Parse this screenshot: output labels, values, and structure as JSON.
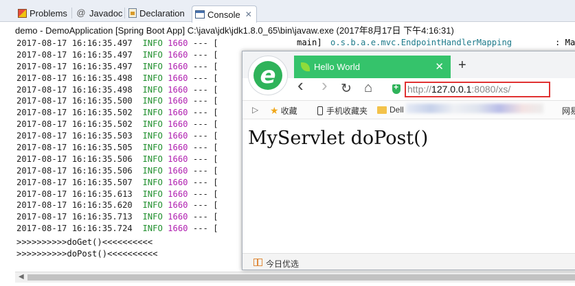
{
  "tabs": [
    {
      "label": "Problems",
      "icon": "problems-icon"
    },
    {
      "label": "Javadoc",
      "icon": "at-sign-icon",
      "glyph": "@"
    },
    {
      "label": "Declaration",
      "icon": "declaration-icon"
    },
    {
      "label": "Console",
      "icon": "console-icon",
      "active": true,
      "close": "✕"
    }
  ],
  "console": {
    "header": "demo - DemoApplication [Spring Boot App] C:\\java\\jdk\\jdk1.8.0_65\\bin\\javaw.exe (2017年8月17日 下午4:16:31)",
    "first_line_thread": "main]",
    "first_line_class": "o.s.b.a.e.mvc.EndpointHandlerMapping",
    "first_line_tail": ": Ma",
    "log_rows": [
      {
        "time": "2017-08-17 16:16:35.497",
        "level": "INFO",
        "pid": "1660",
        "sep": "--- ["
      },
      {
        "time": "2017-08-17 16:16:35.497",
        "level": "INFO",
        "pid": "1660",
        "sep": "--- ["
      },
      {
        "time": "2017-08-17 16:16:35.497",
        "level": "INFO",
        "pid": "1660",
        "sep": "--- ["
      },
      {
        "time": "2017-08-17 16:16:35.498",
        "level": "INFO",
        "pid": "1660",
        "sep": "--- ["
      },
      {
        "time": "2017-08-17 16:16:35.498",
        "level": "INFO",
        "pid": "1660",
        "sep": "--- ["
      },
      {
        "time": "2017-08-17 16:16:35.500",
        "level": "INFO",
        "pid": "1660",
        "sep": "--- ["
      },
      {
        "time": "2017-08-17 16:16:35.502",
        "level": "INFO",
        "pid": "1660",
        "sep": "--- ["
      },
      {
        "time": "2017-08-17 16:16:35.502",
        "level": "INFO",
        "pid": "1660",
        "sep": "--- ["
      },
      {
        "time": "2017-08-17 16:16:35.503",
        "level": "INFO",
        "pid": "1660",
        "sep": "--- ["
      },
      {
        "time": "2017-08-17 16:16:35.505",
        "level": "INFO",
        "pid": "1660",
        "sep": "--- ["
      },
      {
        "time": "2017-08-17 16:16:35.506",
        "level": "INFO",
        "pid": "1660",
        "sep": "--- ["
      },
      {
        "time": "2017-08-17 16:16:35.506",
        "level": "INFO",
        "pid": "1660",
        "sep": "--- ["
      },
      {
        "time": "2017-08-17 16:16:35.507",
        "level": "INFO",
        "pid": "1660",
        "sep": "--- ["
      },
      {
        "time": "2017-08-17 16:16:35.613",
        "level": "INFO",
        "pid": "1660",
        "sep": "--- ["
      },
      {
        "time": "2017-08-17 16:16:35.620",
        "level": "INFO",
        "pid": "1660",
        "sep": "--- ["
      },
      {
        "time": "2017-08-17 16:16:35.713",
        "level": "INFO",
        "pid": "1660",
        "sep": "--- ["
      },
      {
        "time": "2017-08-17 16:16:35.724",
        "level": "INFO",
        "pid": "1660",
        "sep": "--- ["
      }
    ],
    "output_lines": [
      ">>>>>>>>>>doGet()<<<<<<<<<<",
      ">>>>>>>>>>doPost()<<<<<<<<<<"
    ]
  },
  "browser": {
    "tab_title": "Hello World",
    "tab_close": "✕",
    "new_tab": "+",
    "nav": {
      "back": "‹",
      "forward": "›",
      "reload": "↻",
      "home": "⌂"
    },
    "url": {
      "scheme": "http://",
      "host": "127.0.0.1",
      "rest": ":8080/xs/"
    },
    "bookmarks": [
      {
        "label": "收藏",
        "icon": "star-icon"
      },
      {
        "label": "手机收藏夹",
        "icon": "phone-icon"
      },
      {
        "label": "Dell",
        "icon": "folder-icon"
      },
      {
        "label": "网易",
        "icon": ""
      }
    ],
    "bookmark_toggle": "▷",
    "page_text": "MyServlet doPost()",
    "status_label": "今日优选"
  },
  "colors": {
    "level": "#1f8f2c",
    "pid": "#b01fb0",
    "class": "#1d7a8a",
    "browser_tab": "#35c36b",
    "url_border": "#e03232"
  }
}
